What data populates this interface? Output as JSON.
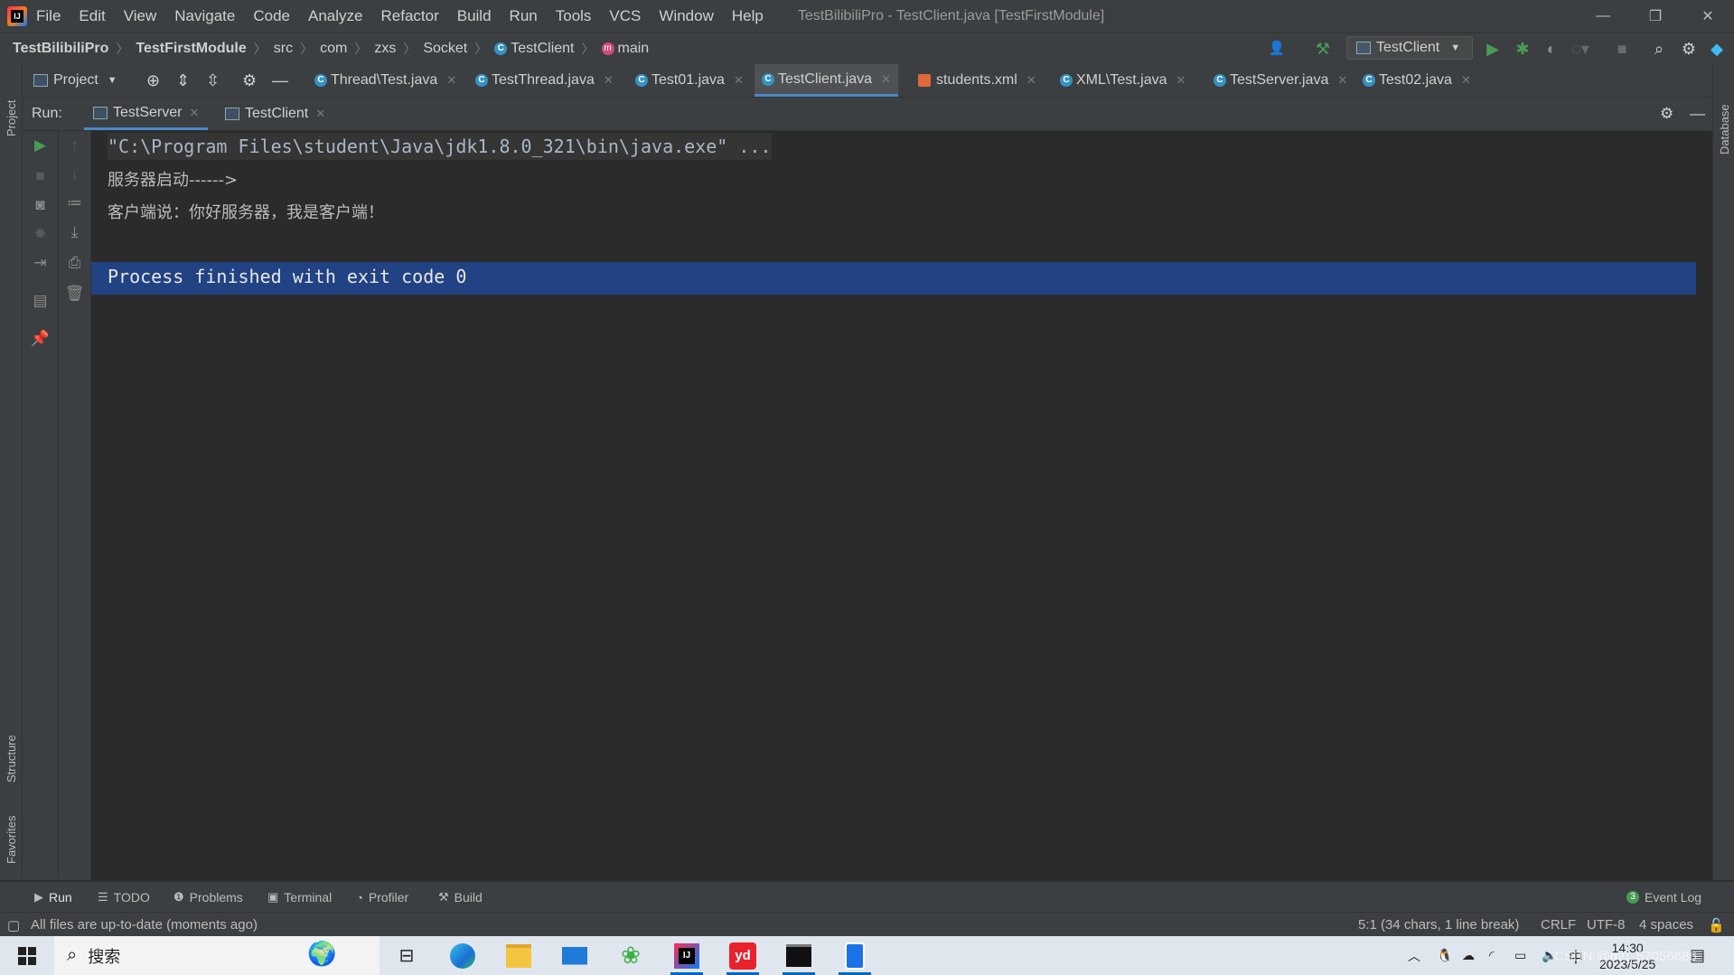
{
  "window": {
    "title": "TestBilibiliPro - TestClient.java [TestFirstModule]",
    "controls": {
      "minimize": "—",
      "restore": "❐",
      "close": "✕"
    }
  },
  "menu": [
    "File",
    "Edit",
    "View",
    "Navigate",
    "Code",
    "Analyze",
    "Refactor",
    "Build",
    "Run",
    "Tools",
    "VCS",
    "Window",
    "Help"
  ],
  "breadcrumb": [
    "TestBilibiliPro",
    "TestFirstModule",
    "src",
    "com",
    "zxs",
    "Socket",
    "TestClient",
    "main"
  ],
  "run_config": "TestClient",
  "project_panel_label": "Project",
  "editor_tabs": [
    {
      "label": "Thread\\Test.java",
      "icon": "java-class-icon"
    },
    {
      "label": "TestThread.java",
      "icon": "java-class-icon"
    },
    {
      "label": "Test01.java",
      "icon": "java-class-icon"
    },
    {
      "label": "TestClient.java",
      "icon": "java-class-icon",
      "active": true
    },
    {
      "label": "students.xml",
      "icon": "xml-file-icon"
    },
    {
      "label": "XML\\Test.java",
      "icon": "java-class-icon"
    },
    {
      "label": "TestServer.java",
      "icon": "java-class-icon"
    },
    {
      "label": "Test02.java",
      "icon": "java-class-icon"
    }
  ],
  "run": {
    "label": "Run:",
    "tabs": [
      {
        "label": "TestServer",
        "active": true
      },
      {
        "label": "TestClient",
        "active": false
      }
    ]
  },
  "console": {
    "command": "\"C:\\Program Files\\student\\Java\\jdk1.8.0_321\\bin\\java.exe\" ...",
    "lines": [
      "服务器启动------>",
      "客户端说：你好服务器，我是客户端！"
    ],
    "finished": "Process finished with exit code 0"
  },
  "side_tabs": {
    "project": "Project",
    "structure": "Structure",
    "favorites": "Favorites",
    "database": "Database"
  },
  "bottom_tabs": [
    "Run",
    "TODO",
    "Problems",
    "Terminal",
    "Profiler",
    "Build"
  ],
  "event_log": {
    "count": "3",
    "label": "Event Log"
  },
  "status": {
    "message": "All files are up-to-date (moments ago)",
    "position": "5:1 (34 chars, 1 line break)",
    "line_sep": "CRLF",
    "encoding": "UTF-8",
    "indent": "4 spaces"
  },
  "taskbar": {
    "search_label": "搜索",
    "time": "14:30",
    "date": "2023/5/25",
    "ime": "中",
    "watermark": "CSDN @m0_57056686"
  },
  "colors": {
    "accent": "#4a88c7",
    "selection": "#214283",
    "run_green": "#499c54"
  }
}
